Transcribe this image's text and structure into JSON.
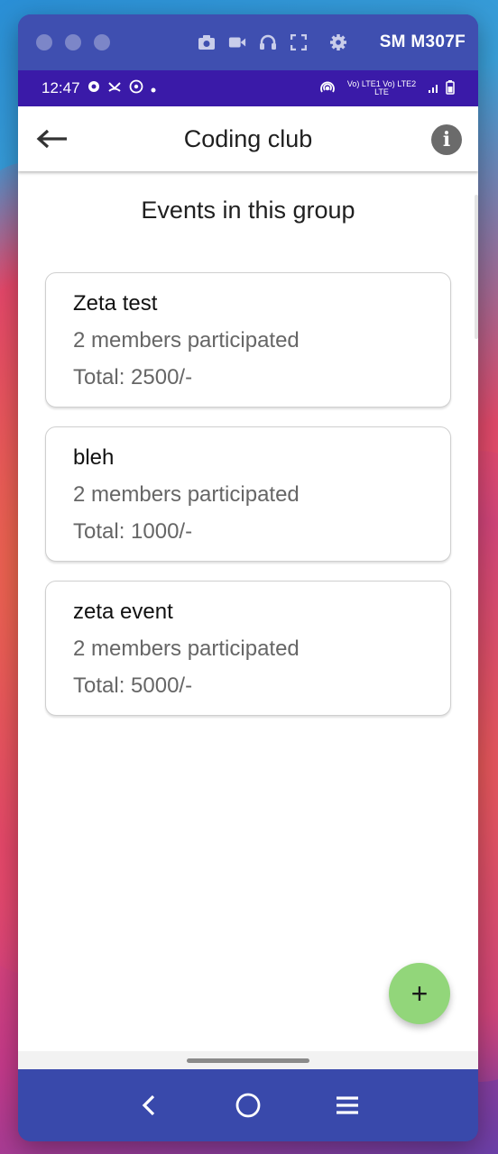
{
  "titlebar": {
    "device_name": "SM M307F",
    "icons": [
      "camera-icon",
      "video-icon",
      "headphones-icon",
      "fullscreen-icon",
      "gear-icon"
    ]
  },
  "statusbar": {
    "time": "12:47",
    "network_text": "Vo) LTE1 Vo) LTE2 LTE"
  },
  "appbar": {
    "title": "Coding club"
  },
  "section_title": "Events in this group",
  "events": [
    {
      "name": "Zeta test",
      "members": "2 members participated",
      "total": "Total: 2500/-"
    },
    {
      "name": "bleh",
      "members": "2 members participated",
      "total": "Total: 1000/-"
    },
    {
      "name": "zeta event",
      "members": "2 members participated",
      "total": "Total: 5000/-"
    }
  ],
  "fab_label": "+",
  "colors": {
    "window_frame": "#3f4fb0",
    "status_bar": "#3a1aa8",
    "fab": "#92d67a",
    "nav_bar": "#3949ab"
  }
}
